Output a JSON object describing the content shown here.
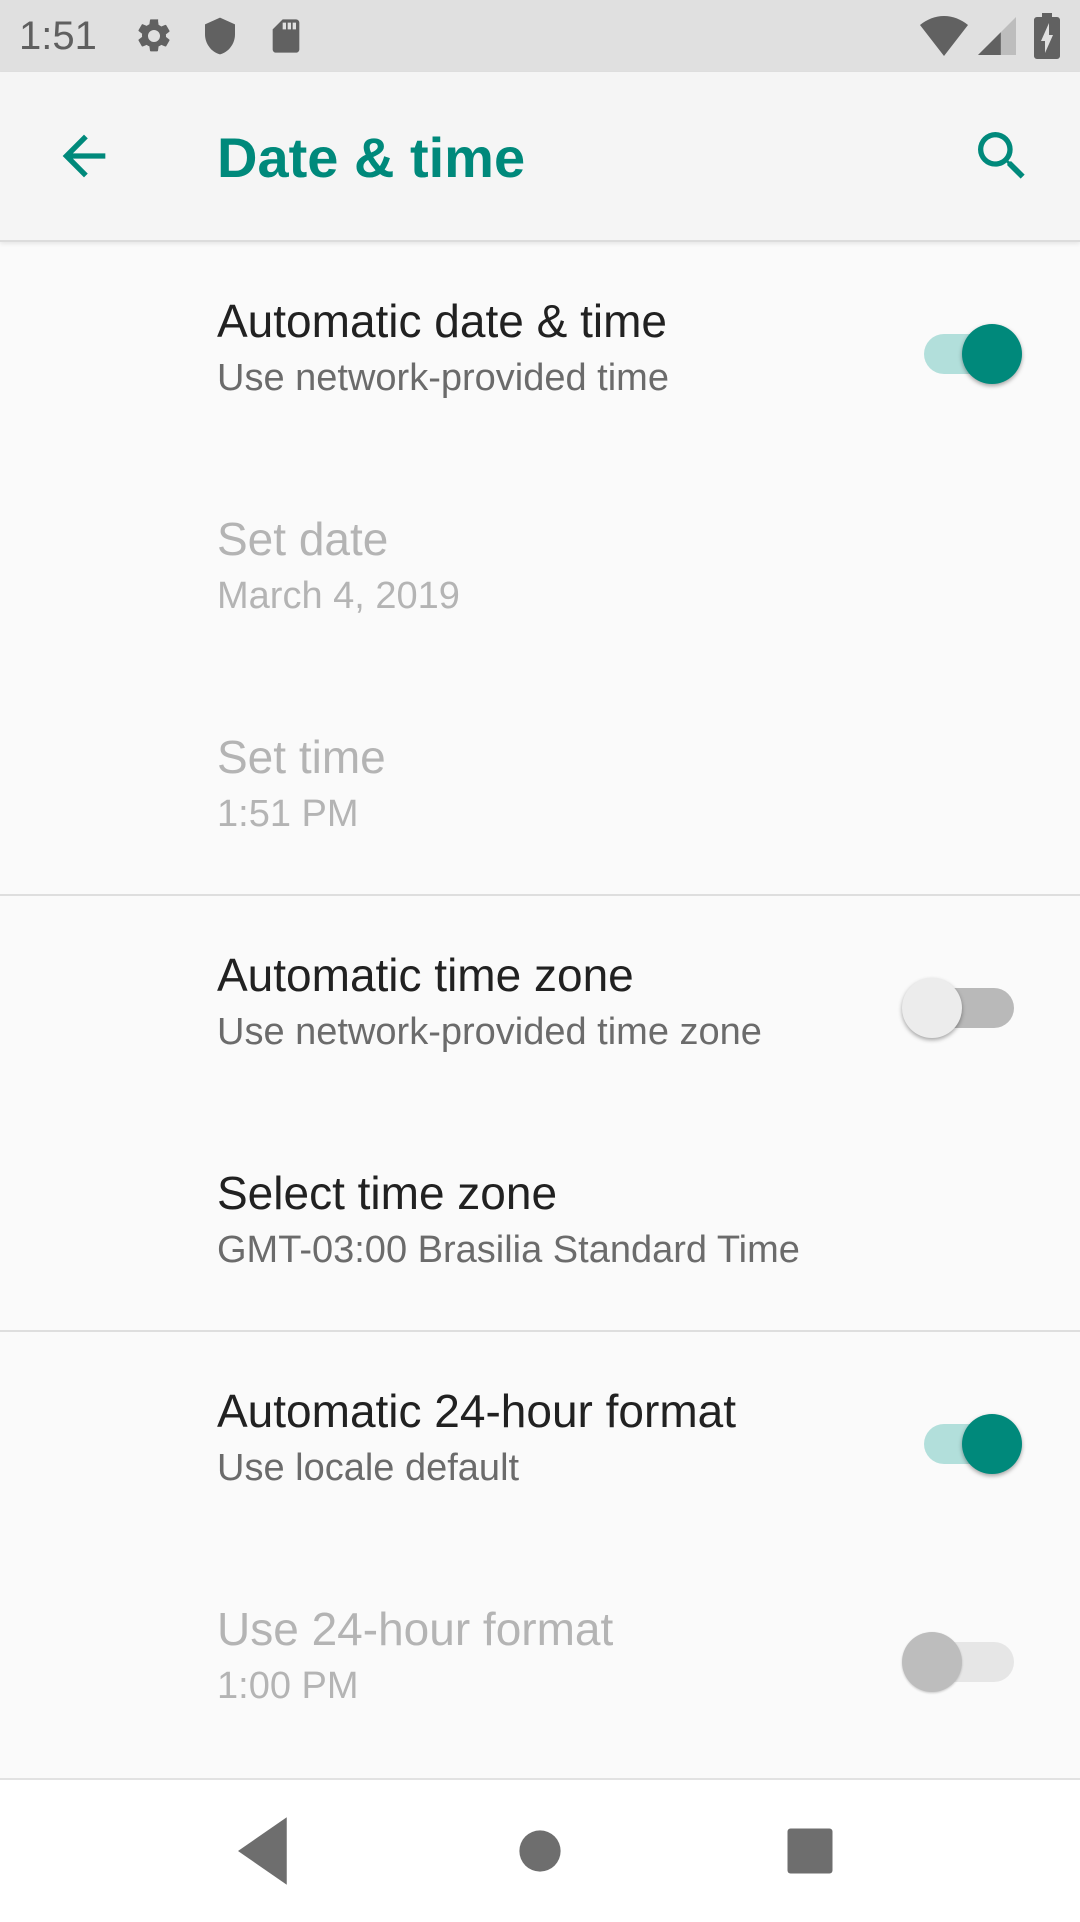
{
  "status_bar": {
    "time": "1:51",
    "left_icons": [
      "settings-gear-icon",
      "shield-icon",
      "sd-card-icon"
    ],
    "right_icons": [
      "wifi-icon",
      "cell-signal-icon",
      "battery-charging-icon"
    ]
  },
  "app_bar": {
    "title": "Date & time",
    "back_icon": "arrow-back-icon",
    "search_icon": "search-icon",
    "accent_color": "#00897b"
  },
  "settings": {
    "automatic_date_time": {
      "title": "Automatic date & time",
      "summary": "Use network-provided time",
      "enabled": true,
      "checked": true
    },
    "set_date": {
      "title": "Set date",
      "summary": "March 4, 2019",
      "enabled": false
    },
    "set_time": {
      "title": "Set time",
      "summary": "1:51 PM",
      "enabled": false
    },
    "automatic_time_zone": {
      "title": "Automatic time zone",
      "summary": "Use network-provided time zone",
      "enabled": true,
      "checked": false
    },
    "select_time_zone": {
      "title": "Select time zone",
      "summary": "GMT-03:00 Brasilia Standard Time",
      "enabled": true
    },
    "automatic_24_hour": {
      "title": "Automatic 24-hour format",
      "summary": "Use locale default",
      "enabled": true,
      "checked": true
    },
    "use_24_hour": {
      "title": "Use 24-hour format",
      "summary": "1:00 PM",
      "enabled": false,
      "checked": false
    }
  },
  "nav_bar": {
    "buttons": [
      "back-triangle-icon",
      "home-circle-icon",
      "recents-square-icon"
    ]
  }
}
